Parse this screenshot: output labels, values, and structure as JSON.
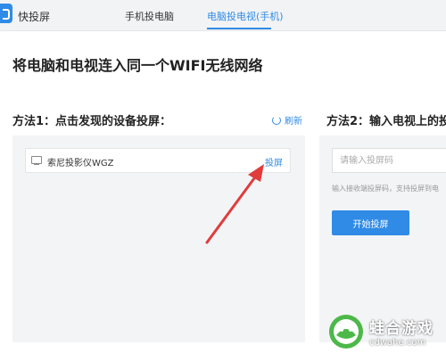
{
  "app": {
    "name": "快投屏"
  },
  "tabs": [
    {
      "label": "手机投电脑",
      "active": false
    },
    {
      "label": "电脑投电视(手机)",
      "active": true
    }
  ],
  "headline": "将电脑和电视连入同一个WIFI无线网络",
  "method1": {
    "title": "方法1：点击发现的设备投屏：",
    "refresh_label": "刷新",
    "devices": [
      {
        "name": "索尼投影仪WGZ",
        "action_label": "投屏",
        "icon": "tv-icon"
      }
    ]
  },
  "method2": {
    "title": "方法2：输入电视上的投",
    "input_placeholder": "请输入投屏码",
    "hint": "输入接收端投屏码，支持投屏到电",
    "start_button": "开始投屏"
  },
  "watermark": {
    "cn": "蛙合游戏",
    "url": "cdwahe.com"
  },
  "colors": {
    "accent": "#2f8be6",
    "arrow": "#e03c3c",
    "panel_bg": "#f3f4f6"
  }
}
